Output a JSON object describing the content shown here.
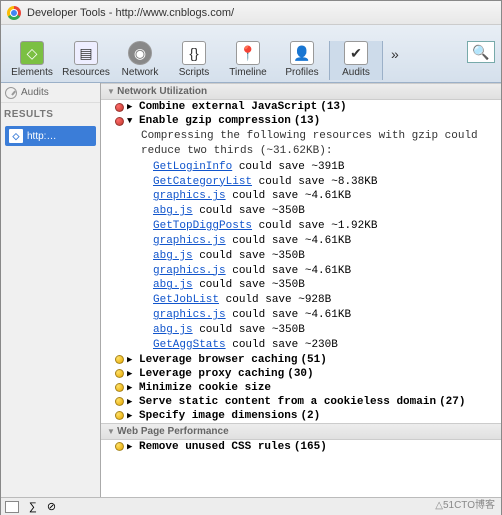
{
  "window": {
    "title": "Developer Tools - http://www.cnblogs.com/"
  },
  "toolbar": {
    "items": [
      {
        "label": "Elements",
        "icon": "◇"
      },
      {
        "label": "Resources",
        "icon": "▤"
      },
      {
        "label": "Network",
        "icon": "◉"
      },
      {
        "label": "Scripts",
        "icon": "{}"
      },
      {
        "label": "Timeline",
        "icon": "📍"
      },
      {
        "label": "Profiles",
        "icon": "👤"
      },
      {
        "label": "Audits",
        "icon": "✔"
      }
    ],
    "more": "»",
    "search_icon": "🔍"
  },
  "sidebar": {
    "audits_label": "Audits",
    "results_label": "RESULTS",
    "result_item": "http:…"
  },
  "sections": {
    "net_util": "Network Utilization",
    "web_perf": "Web Page Performance"
  },
  "rules": {
    "combine_js": {
      "label": "Combine external JavaScript",
      "count": "(13)",
      "sev": "red",
      "open": false
    },
    "gzip": {
      "label": "Enable gzip compression",
      "count": "(13)",
      "sev": "red",
      "open": true,
      "desc": "Compressing the following resources with gzip could reduce two thirds (~31.62KB):",
      "items": [
        {
          "name": "GetLoginInfo",
          "save": "~391B"
        },
        {
          "name": "GetCategoryList",
          "save": "~8.38KB"
        },
        {
          "name": "graphics.js",
          "save": "~4.61KB"
        },
        {
          "name": "abg.js",
          "save": "~350B"
        },
        {
          "name": "GetTopDiggPosts",
          "save": "~1.92KB"
        },
        {
          "name": "graphics.js",
          "save": "~4.61KB"
        },
        {
          "name": "abg.js",
          "save": "~350B"
        },
        {
          "name": "graphics.js",
          "save": "~4.61KB"
        },
        {
          "name": "abg.js",
          "save": "~350B"
        },
        {
          "name": "GetJobList",
          "save": "~928B"
        },
        {
          "name": "graphics.js",
          "save": "~4.61KB"
        },
        {
          "name": "abg.js",
          "save": "~350B"
        },
        {
          "name": "GetAggStats",
          "save": "~230B"
        }
      ]
    },
    "browser_cache": {
      "label": "Leverage browser caching",
      "count": "(51)",
      "sev": "yel",
      "open": false
    },
    "proxy_cache": {
      "label": "Leverage proxy caching",
      "count": "(30)",
      "sev": "yel",
      "open": false
    },
    "cookie": {
      "label": "Minimize cookie size",
      "count": "",
      "sev": "yel",
      "open": false
    },
    "cookieless": {
      "label": "Serve static content from a cookieless domain",
      "count": "(27)",
      "sev": "yel",
      "open": false
    },
    "img_dim": {
      "label": "Specify image dimensions",
      "count": "(2)",
      "sev": "yel",
      "open": false
    },
    "css": {
      "label": "Remove unused CSS rules",
      "count": "(165)",
      "sev": "yel",
      "open": false
    }
  },
  "watermark": "△51CTO博客"
}
